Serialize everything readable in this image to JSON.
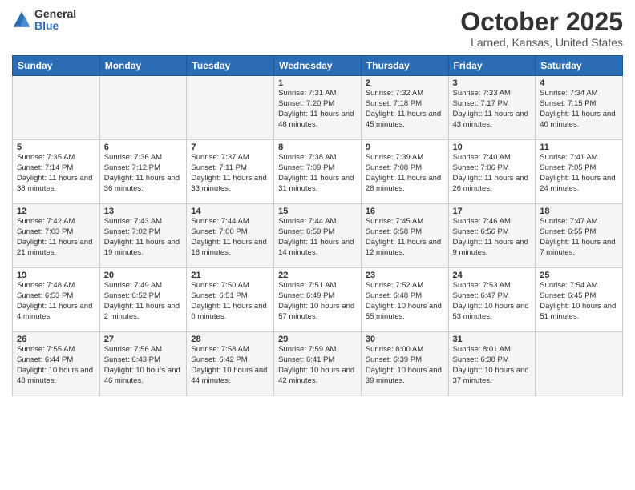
{
  "logo": {
    "general": "General",
    "blue": "Blue"
  },
  "title": "October 2025",
  "location": "Larned, Kansas, United States",
  "weekdays": [
    "Sunday",
    "Monday",
    "Tuesday",
    "Wednesday",
    "Thursday",
    "Friday",
    "Saturday"
  ],
  "weeks": [
    [
      {
        "day": "",
        "info": ""
      },
      {
        "day": "",
        "info": ""
      },
      {
        "day": "",
        "info": ""
      },
      {
        "day": "1",
        "info": "Sunrise: 7:31 AM\nSunset: 7:20 PM\nDaylight: 11 hours and 48 minutes."
      },
      {
        "day": "2",
        "info": "Sunrise: 7:32 AM\nSunset: 7:18 PM\nDaylight: 11 hours and 45 minutes."
      },
      {
        "day": "3",
        "info": "Sunrise: 7:33 AM\nSunset: 7:17 PM\nDaylight: 11 hours and 43 minutes."
      },
      {
        "day": "4",
        "info": "Sunrise: 7:34 AM\nSunset: 7:15 PM\nDaylight: 11 hours and 40 minutes."
      }
    ],
    [
      {
        "day": "5",
        "info": "Sunrise: 7:35 AM\nSunset: 7:14 PM\nDaylight: 11 hours and 38 minutes."
      },
      {
        "day": "6",
        "info": "Sunrise: 7:36 AM\nSunset: 7:12 PM\nDaylight: 11 hours and 36 minutes."
      },
      {
        "day": "7",
        "info": "Sunrise: 7:37 AM\nSunset: 7:11 PM\nDaylight: 11 hours and 33 minutes."
      },
      {
        "day": "8",
        "info": "Sunrise: 7:38 AM\nSunset: 7:09 PM\nDaylight: 11 hours and 31 minutes."
      },
      {
        "day": "9",
        "info": "Sunrise: 7:39 AM\nSunset: 7:08 PM\nDaylight: 11 hours and 28 minutes."
      },
      {
        "day": "10",
        "info": "Sunrise: 7:40 AM\nSunset: 7:06 PM\nDaylight: 11 hours and 26 minutes."
      },
      {
        "day": "11",
        "info": "Sunrise: 7:41 AM\nSunset: 7:05 PM\nDaylight: 11 hours and 24 minutes."
      }
    ],
    [
      {
        "day": "12",
        "info": "Sunrise: 7:42 AM\nSunset: 7:03 PM\nDaylight: 11 hours and 21 minutes."
      },
      {
        "day": "13",
        "info": "Sunrise: 7:43 AM\nSunset: 7:02 PM\nDaylight: 11 hours and 19 minutes."
      },
      {
        "day": "14",
        "info": "Sunrise: 7:44 AM\nSunset: 7:00 PM\nDaylight: 11 hours and 16 minutes."
      },
      {
        "day": "15",
        "info": "Sunrise: 7:44 AM\nSunset: 6:59 PM\nDaylight: 11 hours and 14 minutes."
      },
      {
        "day": "16",
        "info": "Sunrise: 7:45 AM\nSunset: 6:58 PM\nDaylight: 11 hours and 12 minutes."
      },
      {
        "day": "17",
        "info": "Sunrise: 7:46 AM\nSunset: 6:56 PM\nDaylight: 11 hours and 9 minutes."
      },
      {
        "day": "18",
        "info": "Sunrise: 7:47 AM\nSunset: 6:55 PM\nDaylight: 11 hours and 7 minutes."
      }
    ],
    [
      {
        "day": "19",
        "info": "Sunrise: 7:48 AM\nSunset: 6:53 PM\nDaylight: 11 hours and 4 minutes."
      },
      {
        "day": "20",
        "info": "Sunrise: 7:49 AM\nSunset: 6:52 PM\nDaylight: 11 hours and 2 minutes."
      },
      {
        "day": "21",
        "info": "Sunrise: 7:50 AM\nSunset: 6:51 PM\nDaylight: 11 hours and 0 minutes."
      },
      {
        "day": "22",
        "info": "Sunrise: 7:51 AM\nSunset: 6:49 PM\nDaylight: 10 hours and 57 minutes."
      },
      {
        "day": "23",
        "info": "Sunrise: 7:52 AM\nSunset: 6:48 PM\nDaylight: 10 hours and 55 minutes."
      },
      {
        "day": "24",
        "info": "Sunrise: 7:53 AM\nSunset: 6:47 PM\nDaylight: 10 hours and 53 minutes."
      },
      {
        "day": "25",
        "info": "Sunrise: 7:54 AM\nSunset: 6:45 PM\nDaylight: 10 hours and 51 minutes."
      }
    ],
    [
      {
        "day": "26",
        "info": "Sunrise: 7:55 AM\nSunset: 6:44 PM\nDaylight: 10 hours and 48 minutes."
      },
      {
        "day": "27",
        "info": "Sunrise: 7:56 AM\nSunset: 6:43 PM\nDaylight: 10 hours and 46 minutes."
      },
      {
        "day": "28",
        "info": "Sunrise: 7:58 AM\nSunset: 6:42 PM\nDaylight: 10 hours and 44 minutes."
      },
      {
        "day": "29",
        "info": "Sunrise: 7:59 AM\nSunset: 6:41 PM\nDaylight: 10 hours and 42 minutes."
      },
      {
        "day": "30",
        "info": "Sunrise: 8:00 AM\nSunset: 6:39 PM\nDaylight: 10 hours and 39 minutes."
      },
      {
        "day": "31",
        "info": "Sunrise: 8:01 AM\nSunset: 6:38 PM\nDaylight: 10 hours and 37 minutes."
      },
      {
        "day": "",
        "info": ""
      }
    ]
  ]
}
